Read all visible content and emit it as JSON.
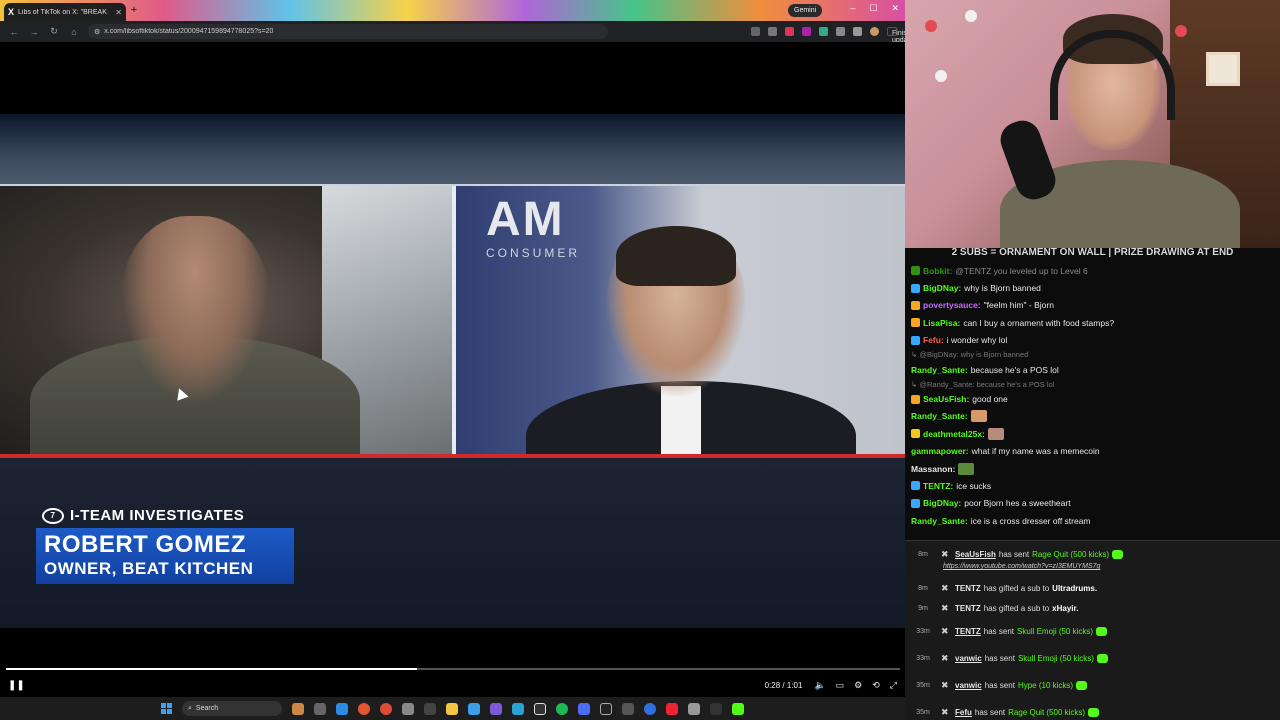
{
  "browser": {
    "tab_title": "Libs of TikTok on X: \"BREAK",
    "new_tab_glyph": "+",
    "gemini_label": "Gemini",
    "url": "x.com/libsoftiktok/status/2000947159894778025?s=20",
    "finish_update_label": "Finish update"
  },
  "video": {
    "lower_third_label": "I-TEAM INVESTIGATES",
    "name": "ROBERT GOMEZ",
    "title": "OWNER, BEAT KITCHEN",
    "backdrop_text": "AM",
    "backdrop_sub": "CONSUMER",
    "time": "0:28 / 1:01",
    "progress": 0.46
  },
  "taskbar": {
    "search_label": "Search"
  },
  "chat": {
    "banner": "2 SUBS = ORNAMENT ON WALL | PRIZE DRAWING AT END",
    "messages": [
      {
        "user": "Bobkit:",
        "text": "@TENTZ you leveled up to Level 6",
        "color": "#53fc18",
        "badge": "#53fc18",
        "faded": true
      },
      {
        "user": "BigDNay:",
        "text": "why is Bjorn banned",
        "color": "#53fc18",
        "badge": "#3aa7ff"
      },
      {
        "user": "povertysauce:",
        "text": "\"feelm him\" - Bjorn",
        "color": "#c86bff",
        "badge": "#f5a623"
      },
      {
        "user": "LisaPisa:",
        "text": "can I buy a ornament with food stamps?",
        "color": "#53fc18",
        "badge": "#f5a623"
      },
      {
        "user": "Fefu:",
        "text": "i wonder why lol",
        "color": "#ff5c5c",
        "badge": "#3aa7ff"
      },
      {
        "reply": "@BigDNay: why is Bjorn banned"
      },
      {
        "user": "Randy_Sante:",
        "text": "because he's a POS lol",
        "color": "#53fc18",
        "badge": ""
      },
      {
        "reply": "@Randy_Sante: because he's a POS lol"
      },
      {
        "user": "SeaUsFish:",
        "text": "good one",
        "color": "#53fc18",
        "badge": "#f5a623"
      },
      {
        "user": "Randy_Sante:",
        "text": "",
        "color": "#53fc18",
        "badge": "",
        "emote": "#d99a6a"
      },
      {
        "user": "deathmetal25x:",
        "text": "",
        "color": "#53fc18",
        "badge": "#f5c518",
        "emote": "#b58b7a"
      },
      {
        "user": "gammapower:",
        "text": "what if my name was a memecoin",
        "color": "#53fc18",
        "badge": ""
      },
      {
        "user": "Massanon:",
        "text": "",
        "color": "#e8e8e8",
        "badge": "",
        "emote": "#5a8a3a"
      },
      {
        "user": "TENTZ:",
        "text": "ice sucks",
        "color": "#53fc18",
        "badge": "#3aa7ff"
      },
      {
        "user": "BigDNay:",
        "text": "poor Bjorn hes a sweetheart",
        "color": "#53fc18",
        "badge": "#3aa7ff"
      },
      {
        "user": "Randy_Sante:",
        "text": "ice is a cross dresser off stream",
        "color": "#53fc18",
        "badge": ""
      }
    ]
  },
  "events": [
    {
      "ago": "8m",
      "user": "SeaUsFish",
      "action": "has sent",
      "item": "Rage Quit (500 kicks)",
      "kick": true
    },
    {
      "link": "https://www.youtube.com/watch?v=zI3EMUYMS7g"
    },
    {
      "ago": "8m",
      "user": "TENTZ",
      "action": "has gifted a sub to",
      "item": "Ultradrums.",
      "kick": false,
      "plain_user": true
    },
    {
      "ago": "9m",
      "user": "TENTZ",
      "action": "has gifted a sub to",
      "item": "xHayir.",
      "kick": false,
      "plain_user": true
    },
    {
      "ago": "33m",
      "user": "TENTZ",
      "action": "has sent",
      "item": "Skull Emoji (50 kicks)",
      "kick": true
    },
    {
      "ago": "33m",
      "user": "vanwic",
      "action": "has sent",
      "item": "Skull Emoji (50 kicks)",
      "kick": true
    },
    {
      "ago": "35m",
      "user": "vanwic",
      "action": "has sent",
      "item": "Hype (10 kicks)",
      "kick": true
    },
    {
      "ago": "35m",
      "user": "Fefu",
      "action": "has sent",
      "item": "Rage Quit (500 kicks)",
      "kick": true
    }
  ]
}
